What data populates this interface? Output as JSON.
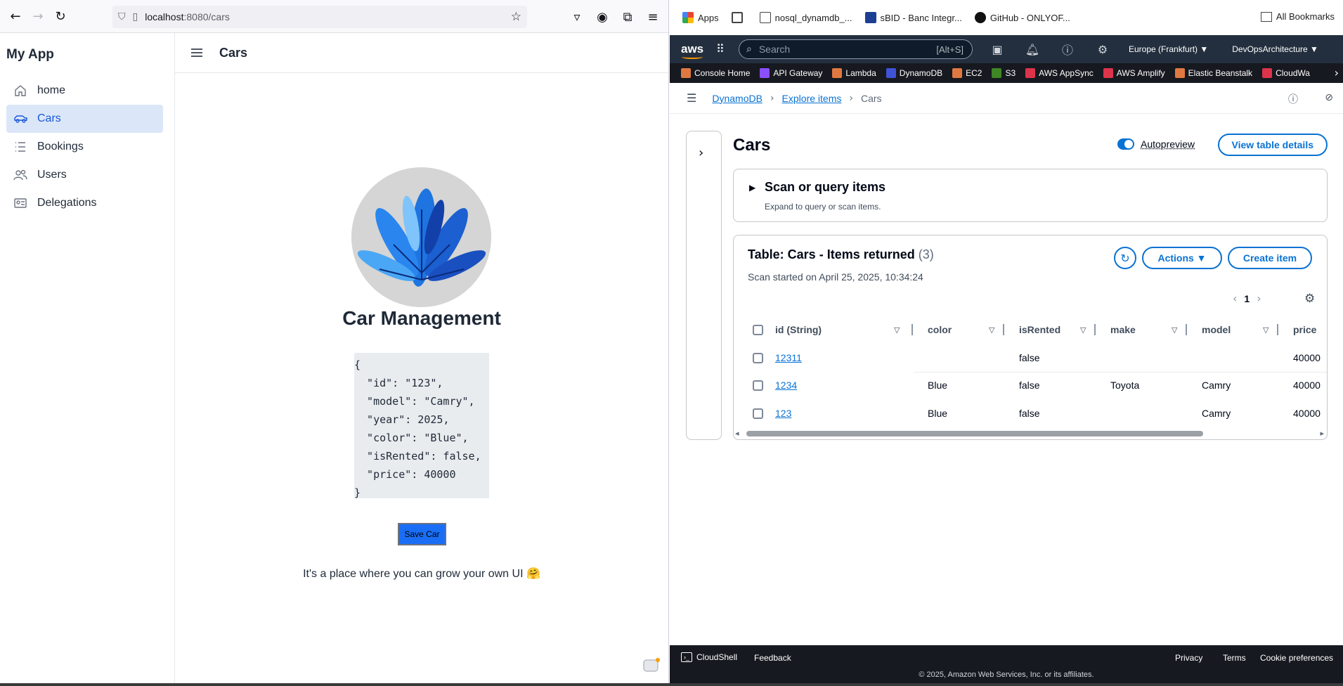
{
  "left_browser": {
    "url_host": "localhost",
    "url_path": ":8080/cars"
  },
  "app": {
    "name": "My App",
    "nav": [
      {
        "label": "home",
        "icon": "home-icon"
      },
      {
        "label": "Cars",
        "icon": "car-icon",
        "active": true
      },
      {
        "label": "Bookings",
        "icon": "list-icon"
      },
      {
        "label": "Users",
        "icon": "users-icon"
      },
      {
        "label": "Delegations",
        "icon": "id-card-icon"
      }
    ],
    "header_title": "Cars",
    "main_title": "Car Management",
    "json_text": "{\n  \"id\": \"123\",\n  \"model\": \"Camry\",\n  \"year\": 2025,\n  \"color\": \"Blue\",\n  \"isRented\": false,\n  \"price\": 40000\n}",
    "save_label": "Save Car",
    "tagline": "It's a place where you can grow your own UI 🤗"
  },
  "bookmarks": {
    "items": [
      "Apps",
      "nosql_dynamdb_...",
      "sBID - Banc Integr...",
      "GitHub - ONLYOF..."
    ],
    "all": "All Bookmarks"
  },
  "aws": {
    "logo": "aws",
    "search_placeholder": "Search",
    "search_shortcut": "[Alt+S]",
    "region": "Europe (Frankfurt) ▼",
    "account": "DevOpsArchitecture ▼",
    "favorites": [
      "Console Home",
      "API Gateway",
      "Lambda",
      "DynamoDB",
      "EC2",
      "S3",
      "AWS AppSync",
      "AWS Amplify",
      "Elastic Beanstalk",
      "CloudWa"
    ],
    "favorite_colors": [
      "#e07941",
      "#8c4fff",
      "#e07941",
      "#4053d6",
      "#e07941",
      "#3f8624",
      "#dd344c",
      "#dd344c",
      "#e07941",
      "#dd344c"
    ],
    "breadcrumb": {
      "root": "DynamoDB",
      "mid": "Explore items",
      "current": "Cars"
    },
    "page_title": "Cars",
    "autopreview_label": "Autopreview",
    "view_details_label": "View table details",
    "scan_title": "Scan or query items",
    "scan_desc": "Expand to query or scan items.",
    "table_title": "Table: Cars - Items returned",
    "table_count": "(3)",
    "scan_started": "Scan started on April 25, 2025, 10:34:24",
    "actions_label": "Actions ▼",
    "create_label": "Create item",
    "page_number": "1",
    "columns": [
      "id (String)",
      "color",
      "isRented",
      "make",
      "model",
      "price"
    ],
    "rows": [
      {
        "id": "12311",
        "color": "",
        "isRented": "false",
        "make": "",
        "model": "",
        "price": "40000"
      },
      {
        "id": "1234",
        "color": "Blue",
        "isRented": "false",
        "make": "Toyota",
        "model": "Camry",
        "price": "40000"
      },
      {
        "id": "123",
        "color": "Blue",
        "isRented": "false",
        "make": "",
        "model": "Camry",
        "price": "40000"
      }
    ],
    "footer": {
      "cloudshell": "CloudShell",
      "feedback": "Feedback",
      "privacy": "Privacy",
      "terms": "Terms",
      "cookies": "Cookie preferences",
      "copyright": "© 2025, Amazon Web Services, Inc. or its affiliates."
    },
    "accent": "#0972d3",
    "dark": "#232f3e"
  }
}
